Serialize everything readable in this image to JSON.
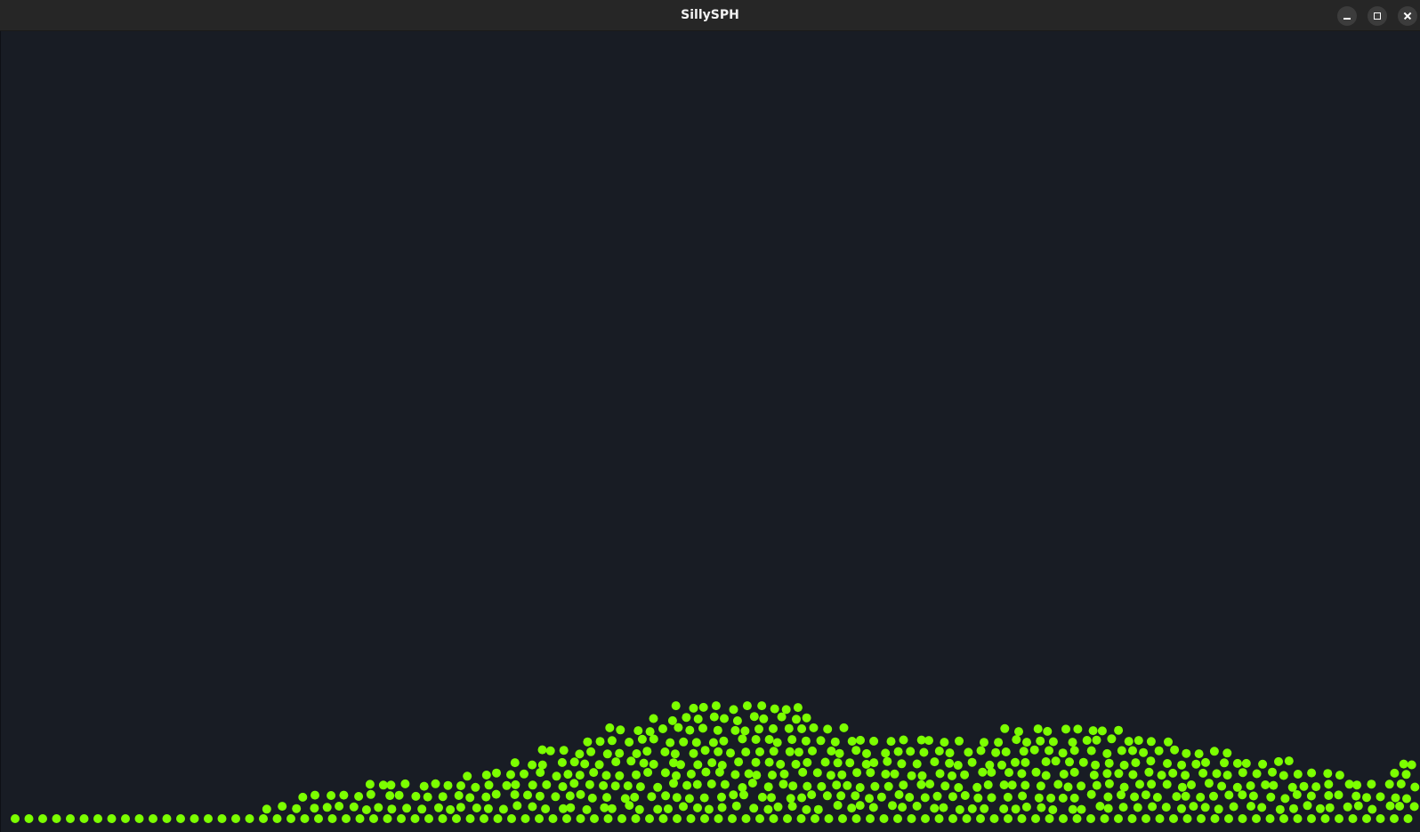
{
  "window": {
    "title": "SillySPH"
  },
  "controls": {
    "minimize_icon": "minimize-icon",
    "maximize_icon": "maximize-icon",
    "close_icon": "close-icon"
  },
  "simulation": {
    "background_color": "#181c24",
    "particle_color": "#7cff00"
  }
}
